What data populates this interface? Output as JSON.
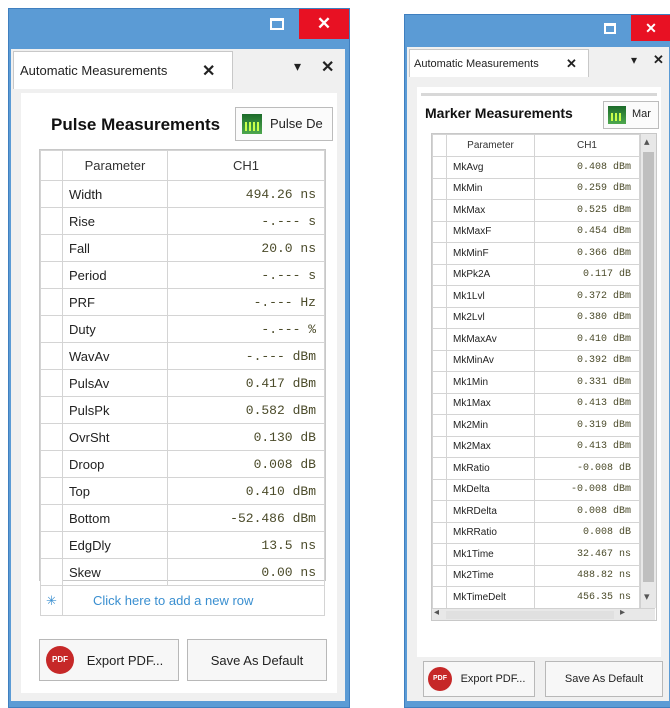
{
  "left": {
    "tab_label": "Automatic Measurements",
    "tab_close": "✕",
    "dropdown_glyph": "▾",
    "pane_close": "✕",
    "heading": "Pulse Measurements",
    "mode_button": "Pulse De",
    "columns": [
      "Parameter",
      "CH1"
    ],
    "rows": [
      {
        "param": "Width",
        "value": "494.26 ns"
      },
      {
        "param": "Rise",
        "value": "-.--- s"
      },
      {
        "param": "Fall",
        "value": "20.0 ns"
      },
      {
        "param": "Period",
        "value": "-.--- s"
      },
      {
        "param": "PRF",
        "value": "-.--- Hz"
      },
      {
        "param": "Duty",
        "value": "-.--- %"
      },
      {
        "param": "WavAv",
        "value": "-.--- dBm"
      },
      {
        "param": "PulsAv",
        "value": "0.417 dBm"
      },
      {
        "param": "PulsPk",
        "value": "0.582 dBm"
      },
      {
        "param": "OvrSht",
        "value": "0.130 dB"
      },
      {
        "param": "Droop",
        "value": "0.008 dB"
      },
      {
        "param": "Top",
        "value": "0.410 dBm"
      },
      {
        "param": "Bottom",
        "value": "-52.486 dBm"
      },
      {
        "param": "EdgDly",
        "value": "13.5 ns"
      },
      {
        "param": "Skew",
        "value": "0.00 ns"
      }
    ],
    "add_row_star": "✳",
    "add_row": "Click here to add a new row",
    "export_label": "Export PDF...",
    "default_label": "Save As Default",
    "pdf_badge": "PDF",
    "close_glyph": "✕"
  },
  "right": {
    "tab_label": "Automatic Measurements",
    "tab_close": "✕",
    "dropdown_glyph": "▾",
    "pane_close": "✕",
    "heading": "Marker Measurements",
    "mode_button": "Mar",
    "columns": [
      "Parameter",
      "CH1"
    ],
    "rows": [
      {
        "param": "MkAvg",
        "value": "0.408 dBm"
      },
      {
        "param": "MkMin",
        "value": "0.259 dBm"
      },
      {
        "param": "MkMax",
        "value": "0.525 dBm"
      },
      {
        "param": "MkMaxF",
        "value": "0.454 dBm"
      },
      {
        "param": "MkMinF",
        "value": "0.366 dBm"
      },
      {
        "param": "MkPk2A",
        "value": "0.117 dB"
      },
      {
        "param": "Mk1Lvl",
        "value": "0.372 dBm"
      },
      {
        "param": "Mk2Lvl",
        "value": "0.380 dBm"
      },
      {
        "param": "MkMaxAv",
        "value": "0.410 dBm"
      },
      {
        "param": "MkMinAv",
        "value": "0.392 dBm"
      },
      {
        "param": "Mk1Min",
        "value": "0.331 dBm"
      },
      {
        "param": "Mk1Max",
        "value": "0.413 dBm"
      },
      {
        "param": "Mk2Min",
        "value": "0.319 dBm"
      },
      {
        "param": "Mk2Max",
        "value": "0.413 dBm"
      },
      {
        "param": "MkRatio",
        "value": "-0.008 dB"
      },
      {
        "param": "MkDelta",
        "value": "-0.008 dBm"
      },
      {
        "param": "MkRDelta",
        "value": "0.008 dBm"
      },
      {
        "param": "MkRRatio",
        "value": "0.008 dB"
      },
      {
        "param": "Mk1Time",
        "value": "32.467 ns"
      },
      {
        "param": "Mk2Time",
        "value": "488.82 ns"
      },
      {
        "param": "MkTimeDelt",
        "value": "456.35 ns"
      }
    ],
    "export_label": "Export PDF...",
    "default_label": "Save As Default",
    "pdf_badge": "PDF",
    "close_glyph": "✕",
    "scroll_up": "▴",
    "scroll_down": "▾",
    "scroll_left": "◂",
    "scroll_right": "▸"
  },
  "colors": {
    "title_blue": "#5b9bd5",
    "close_red": "#e81123",
    "value_text": "#4b4b2a",
    "link_blue": "#3a8fd0"
  }
}
